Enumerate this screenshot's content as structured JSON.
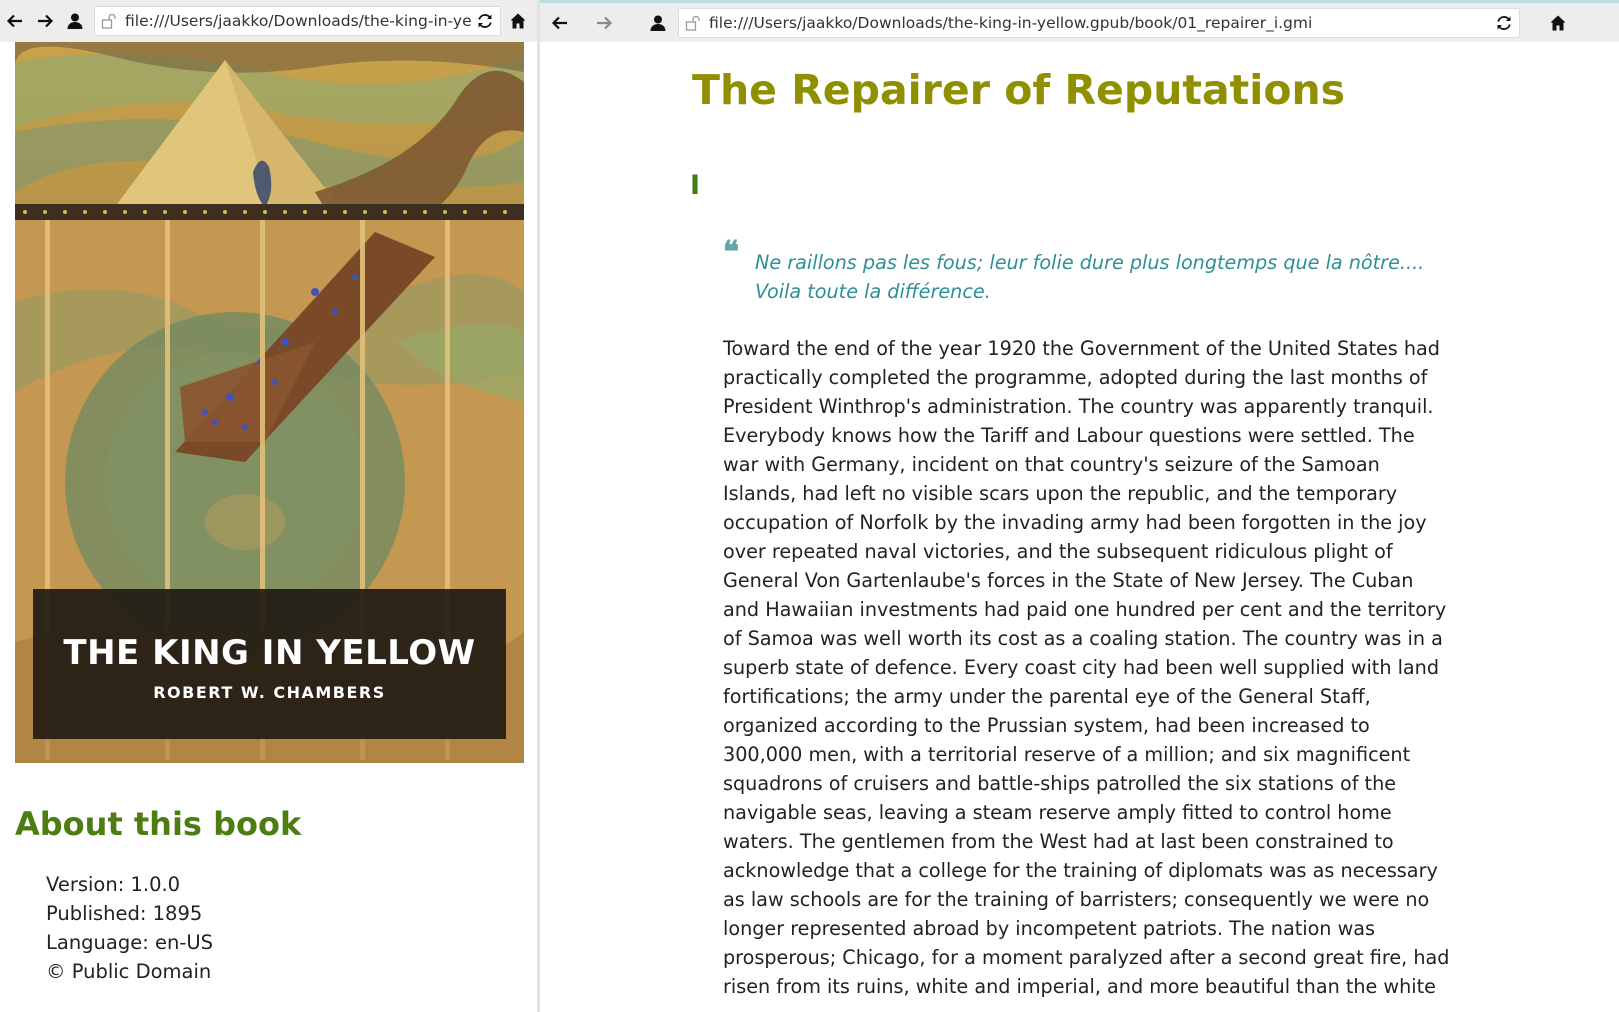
{
  "left_pane": {
    "url": "file:///Users/jaakko/Downloads/the-king-in-yello",
    "cover": {
      "title": "THE KING IN YELLOW",
      "author": "ROBERT W. CHAMBERS"
    },
    "about_heading": "About this book",
    "metadata": [
      "Version: 1.0.0",
      "Published: 1895",
      "Language: en-US",
      "© Public Domain"
    ]
  },
  "right_pane": {
    "url": "file:///Users/jaakko/Downloads/the-king-in-yellow.gpub/book/01_repairer_i.gmi",
    "chapter_title": "The Repairer of Reputations",
    "section_numeral": "I",
    "quote_mark": "❝",
    "epigraph_lines": [
      "Ne raillons pas les fous; leur folie dure plus longtemps que la nôtre....",
      "Voila toute la différence."
    ],
    "body_lines": [
      "Toward the end of the year 1920 the Government of the United States had",
      "practically completed the programme, adopted during the last months of",
      "President Winthrop's administration. The country was apparently tranquil.",
      "Everybody knows how the Tariff and Labour questions were settled. The",
      "war with Germany, incident on that country's seizure of the Samoan",
      "Islands, had left no visible scars upon the republic, and the temporary",
      "occupation of Norfolk by the invading army had been forgotten in the joy",
      "over repeated naval victories, and the subsequent ridiculous plight of",
      "General Von Gartenlaube's forces in the State of New Jersey. The Cuban",
      "and Hawaiian investments had paid one hundred per cent and the territory",
      "of Samoa was well worth its cost as a coaling station. The country was in a",
      "superb state of defence. Every coast city had been well supplied with land",
      "fortifications; the army under the parental eye of the General Staff,",
      "organized according to the Prussian system, had been increased to",
      "300,000 men, with a territorial reserve of a million; and six magnificent",
      "squadrons of cruisers and battle-ships patrolled the six stations of the",
      "navigable seas, leaving a steam reserve amply fitted to control home",
      "waters. The gentlemen from the West had at last been constrained to",
      "acknowledge that a college for the training of diplomats was as necessary",
      "as law schools are for the training of barristers; consequently we were no",
      "longer represented abroad by incompetent patriots. The nation was",
      "prosperous; Chicago, for a moment paralyzed after a second great fire, had",
      "risen from its ruins, white and imperial, and more beautiful than the white"
    ]
  },
  "colors": {
    "chapter_title": "#8f8f00",
    "about_heading": "#4d7d12",
    "section_numeral": "#3f7d18",
    "epigraph": "#2f8f98",
    "toolbar": "#ededed"
  },
  "icons": [
    "back-arrow-icon",
    "forward-arrow-icon",
    "user-icon",
    "lock-icon",
    "reload-icon",
    "home-icon"
  ]
}
